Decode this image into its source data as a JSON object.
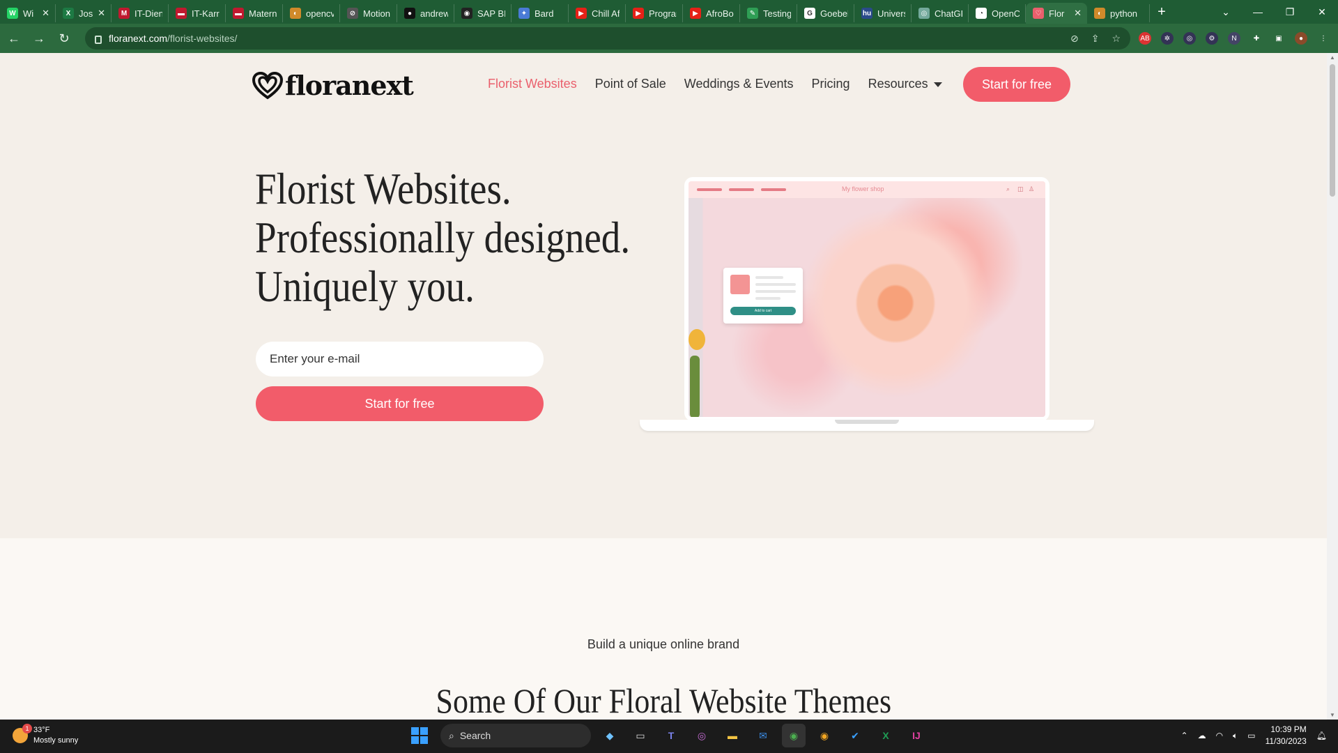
{
  "browser": {
    "tabs": [
      {
        "label": "Wi",
        "color": "#25d366",
        "glyph": "W",
        "closable": true
      },
      {
        "label": "Jos",
        "color": "#1d7a44",
        "glyph": "X",
        "closable": true
      },
      {
        "label": "IT-Dien",
        "color": "#c0192f",
        "glyph": "M",
        "closable": false
      },
      {
        "label": "IT-Karri",
        "color": "#c0192f",
        "glyph": "▬",
        "closable": false
      },
      {
        "label": "Matern",
        "color": "#c0192f",
        "glyph": "▬",
        "closable": false
      },
      {
        "label": "opencv",
        "color": "#d08a2a",
        "glyph": "◐",
        "closable": false
      },
      {
        "label": "Motion",
        "color": "#555555",
        "glyph": "⊘",
        "closable": false
      },
      {
        "label": "andrew",
        "color": "#111111",
        "glyph": "●",
        "closable": false
      },
      {
        "label": "SAP BI D",
        "color": "#222222",
        "glyph": "◉",
        "closable": false
      },
      {
        "label": "Bard",
        "color": "#4a7bd6",
        "glyph": "✦",
        "closable": false
      },
      {
        "label": "Chill Afr",
        "color": "#e62117",
        "glyph": "▶",
        "closable": false
      },
      {
        "label": "Progran",
        "color": "#e62117",
        "glyph": "▶",
        "closable": false
      },
      {
        "label": "AfroBop",
        "color": "#e62117",
        "glyph": "▶",
        "closable": false
      },
      {
        "label": "Testing",
        "color": "#2f9e55",
        "glyph": "✎",
        "closable": false
      },
      {
        "label": "Goebel,",
        "color": "#ffffff",
        "glyph": "G",
        "closable": false
      },
      {
        "label": "Univers",
        "color": "#2a4a8a",
        "glyph": "hu",
        "closable": false
      },
      {
        "label": "ChatGP",
        "color": "#74aa9c",
        "glyph": "◎",
        "closable": false
      },
      {
        "label": "OpenCV",
        "color": "#ffffff",
        "glyph": "◔",
        "closable": false
      },
      {
        "label": "Flor",
        "color": "#ea5f6c",
        "glyph": "♡",
        "closable": true,
        "active": true
      },
      {
        "label": "python",
        "color": "#d08a2a",
        "glyph": "◐",
        "closable": false
      }
    ],
    "url_host": "floranext.com",
    "url_path": "/florist-websites/"
  },
  "site": {
    "logo_text": "floranext",
    "nav": [
      {
        "label": "Florist Websites",
        "active": true
      },
      {
        "label": "Point of Sale"
      },
      {
        "label": "Weddings & Events"
      },
      {
        "label": "Pricing"
      },
      {
        "label": "Resources",
        "dropdown": true
      }
    ],
    "nav_cta": "Start for free",
    "hero": {
      "lines": [
        "Florist Websites.",
        "Professionally designed.",
        "Uniquely you."
      ],
      "email_placeholder": "Enter your e-mail",
      "cta": "Start for free"
    },
    "mockup": {
      "shop_title": "My flower shop",
      "card_button": "Add to cart"
    },
    "section": {
      "tagline": "Build a unique online brand",
      "title": "Some Of Our Floral Website Themes"
    }
  },
  "taskbar": {
    "weather_temp": "33°F",
    "weather_desc": "Mostly sunny",
    "weather_badge": "1",
    "search_label": "Search",
    "time": "10:39 PM",
    "date": "11/30/2023"
  },
  "colors": {
    "accent": "#f25c6a",
    "nav_active": "#ea5f6c",
    "chrome_frame": "#1f5c34"
  }
}
